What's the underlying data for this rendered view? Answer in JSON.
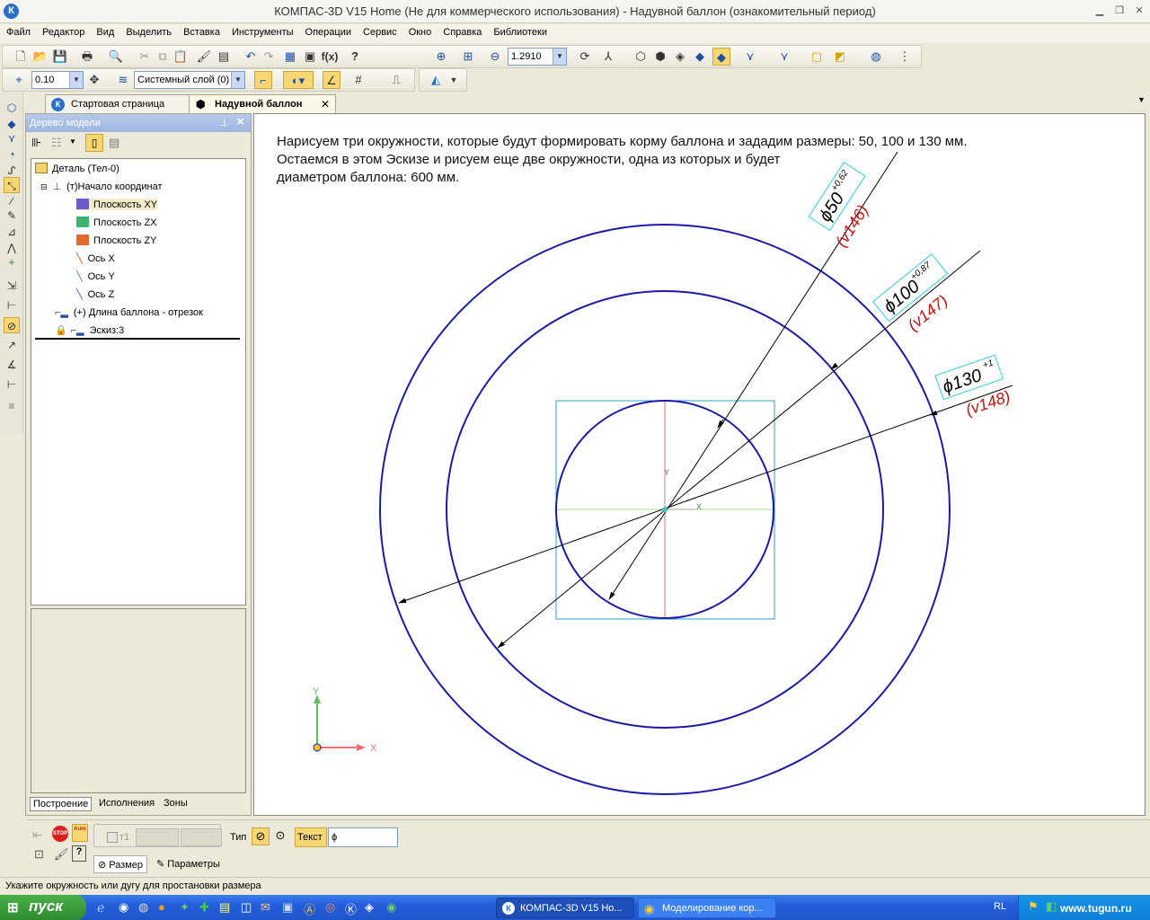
{
  "window": {
    "title": "КОМПАС-3D V15 Home (Не для коммерческого использования) - Надувной баллон (ознакомительный период)",
    "app_icon": "kompas-logo-icon"
  },
  "menu": [
    "Файл",
    "Редактор",
    "Вид",
    "Выделить",
    "Вставка",
    "Инструменты",
    "Операции",
    "Сервис",
    "Окно",
    "Справка",
    "Библиотеки"
  ],
  "toolbar": {
    "zoom_value": "1.2910",
    "step_value": "0.10",
    "layer_value": "Системный слой (0)"
  },
  "tabs": [
    {
      "label": "Стартовая страница",
      "active": false
    },
    {
      "label": "Надувной баллон",
      "active": true
    }
  ],
  "tree_panel": {
    "title": "Дерево модели",
    "nodes": [
      {
        "label": "Деталь (Тел-0)",
        "icon": "part-icon"
      },
      {
        "label": "(т)Начало координат",
        "icon": "origin-icon"
      },
      {
        "label": "Плоскость XY",
        "icon": "plane-xy-icon",
        "color": "#6a5acd"
      },
      {
        "label": "Плоскость ZX",
        "icon": "plane-zx-icon",
        "color": "#3cb371"
      },
      {
        "label": "Плоскость ZY",
        "icon": "plane-zy-icon",
        "color": "#e06a2c"
      },
      {
        "label": "Ось X",
        "icon": "axis-x-icon",
        "color": "#e0552c"
      },
      {
        "label": "Ось Y",
        "icon": "axis-y-icon",
        "color": "#2e9b3c"
      },
      {
        "label": "Ось Z",
        "icon": "axis-z-icon",
        "color": "#7a3fb0"
      },
      {
        "label": "(+) Длина баллона - отрезок",
        "icon": "sketch-icon"
      },
      {
        "label": "Эскиз:3",
        "icon": "sketch-lock-icon"
      }
    ],
    "bottom_tabs": [
      "Построение",
      "Исполнения",
      "Зоны"
    ]
  },
  "canvas": {
    "hint_lines": [
      "Нарисуем три окружности, которые будут формировать корму баллона и зададим размеры: 50, 100 и 130 мм.",
      "Остаемся в этом Эскизе и рисуем еще две окружности, одна из которых и будет",
      "диаметром баллона: 600 мм."
    ],
    "dimensions": [
      {
        "text": "ϕ50",
        "tolerance": "+0,62",
        "variable": "(v146)"
      },
      {
        "text": "ϕ100",
        "tolerance": "+0,87",
        "variable": "(v147)"
      },
      {
        "text": "ϕ130",
        "tolerance": "+1",
        "variable": "(v148)"
      }
    ],
    "axis_labels": {
      "x": "X",
      "y": "Y"
    },
    "colors": {
      "circle": "#1a1aa8",
      "dimension": "#000000",
      "variable": "#cc1111",
      "frame": "#2a9fd6"
    }
  },
  "property_panel": {
    "t1_label": "т1",
    "type_label": "Тип",
    "text_label": "Текст",
    "text_value": "ϕ",
    "tabs": [
      "Размер",
      "Параметры"
    ],
    "stop_label": "STOP",
    "auto_label": "Auto"
  },
  "status": "Укажите окружность или дугу для простановки размера",
  "taskbar": {
    "start_label": "пуск",
    "tasks": [
      "КОМПАС-3D V15 Ho...",
      "Моделирование кор..."
    ],
    "lang": "RL",
    "watermark": "www.tugun.ru"
  }
}
